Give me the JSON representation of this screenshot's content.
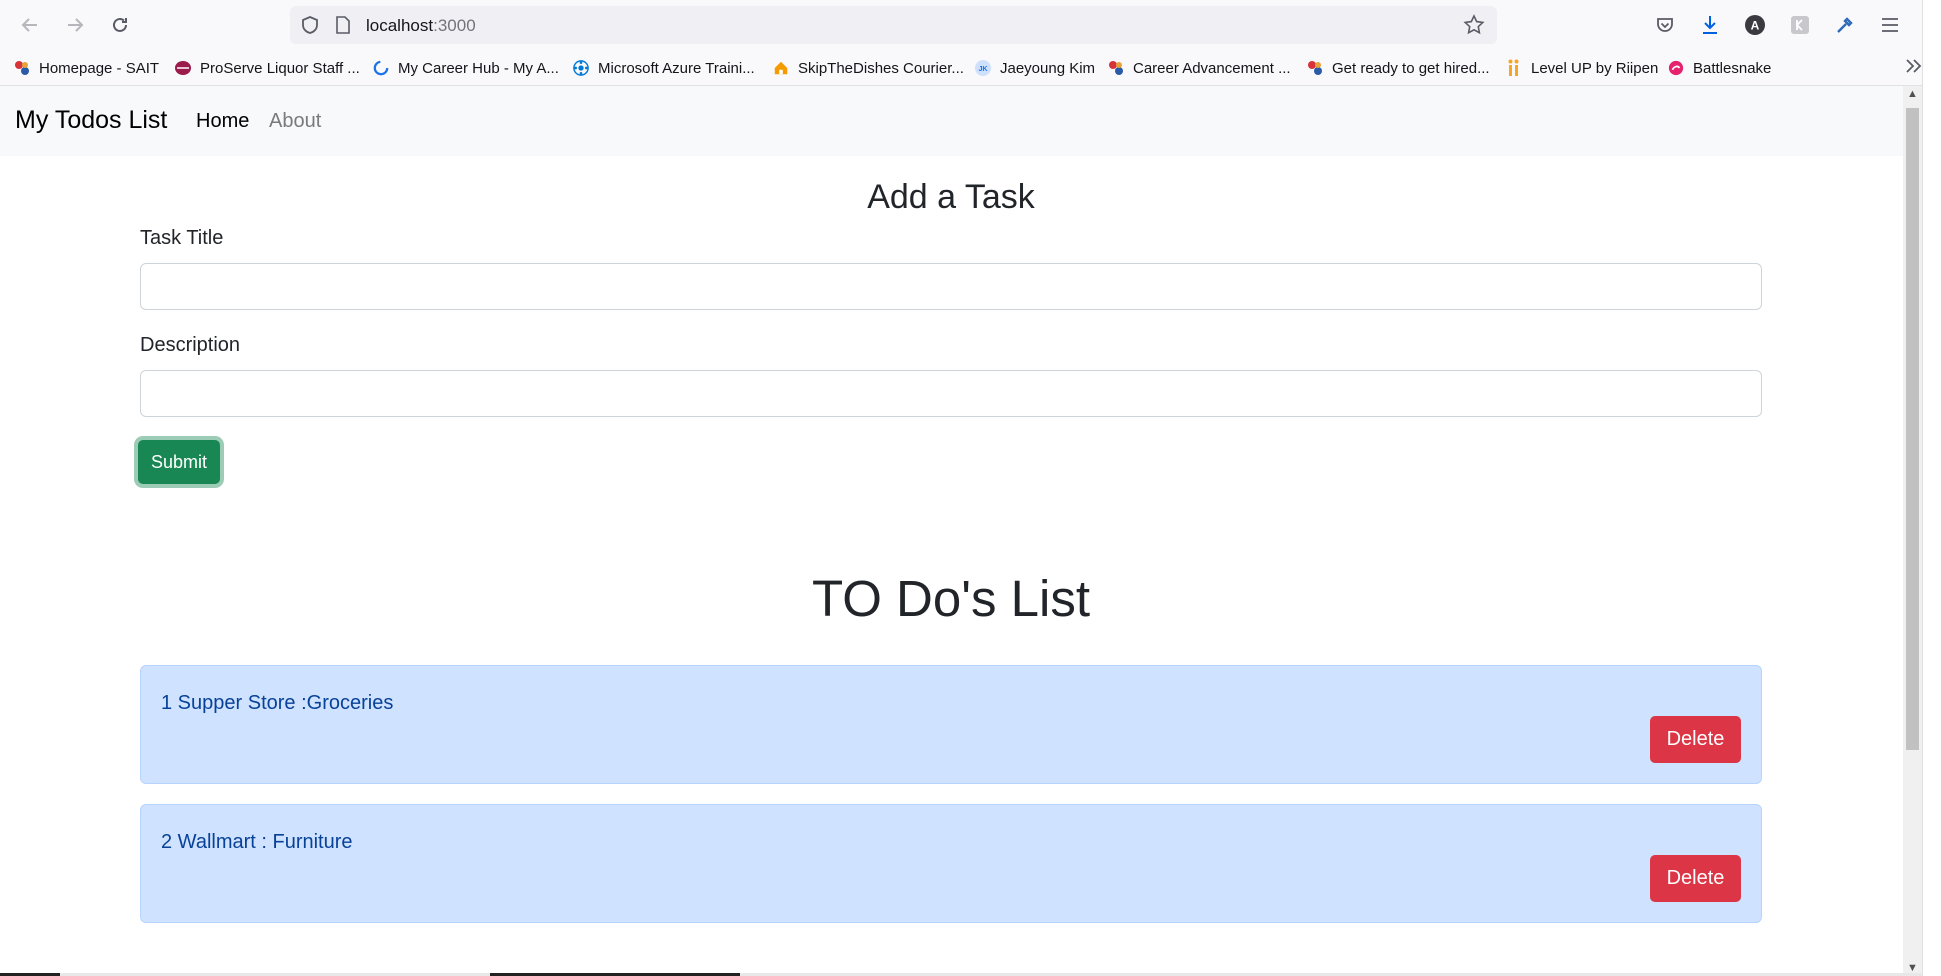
{
  "browser": {
    "url_host": "localhost",
    "url_port": ":3000",
    "bookmarks": [
      {
        "label": "Homepage - SAIT",
        "icon": "sait-icon",
        "color": "#d6333a"
      },
      {
        "label": "ProServe Liquor Staff ...",
        "icon": "proserve-icon",
        "color": "#9b1b4b"
      },
      {
        "label": "My Career Hub - My A...",
        "icon": "career-hub-icon",
        "color": "#1a73e8"
      },
      {
        "label": "Microsoft Azure Traini...",
        "icon": "azure-icon",
        "color": "#0078d4"
      },
      {
        "label": "SkipTheDishes Courier...",
        "icon": "skipthedishes-icon",
        "color": "#f59b00"
      },
      {
        "label": "Jaeyoung Kim",
        "icon": "jk-avatar-icon",
        "color": "#1a73e8"
      },
      {
        "label": "Career Advancement ...",
        "icon": "sait-icon",
        "color": "#d6333a"
      },
      {
        "label": "Get ready to get hired...",
        "icon": "sait-icon",
        "color": "#d6333a"
      },
      {
        "label": "Level UP by Riipen",
        "icon": "riipen-icon",
        "color": "#f5a623"
      },
      {
        "label": "Battlesnake",
        "icon": "battlesnake-icon",
        "color": "#e6226e"
      }
    ]
  },
  "navbar": {
    "brand": "My Todos List",
    "links": [
      {
        "label": "Home"
      },
      {
        "label": "About"
      }
    ]
  },
  "form": {
    "heading": "Add a Task",
    "title_label": "Task Title",
    "title_value": "",
    "description_label": "Description",
    "description_value": "",
    "submit_label": "Submit"
  },
  "list": {
    "heading": "TO Do's List",
    "items": [
      {
        "text": "1 Supper Store :Groceries",
        "delete_label": "Delete"
      },
      {
        "text": "2 Wallmart : Furniture",
        "delete_label": "Delete"
      }
    ]
  },
  "colors": {
    "submit": "#198754",
    "delete": "#dc3545",
    "todo_bg": "#cfe2ff",
    "todo_text": "#084298",
    "navbar_bg": "#f8f9fa"
  }
}
